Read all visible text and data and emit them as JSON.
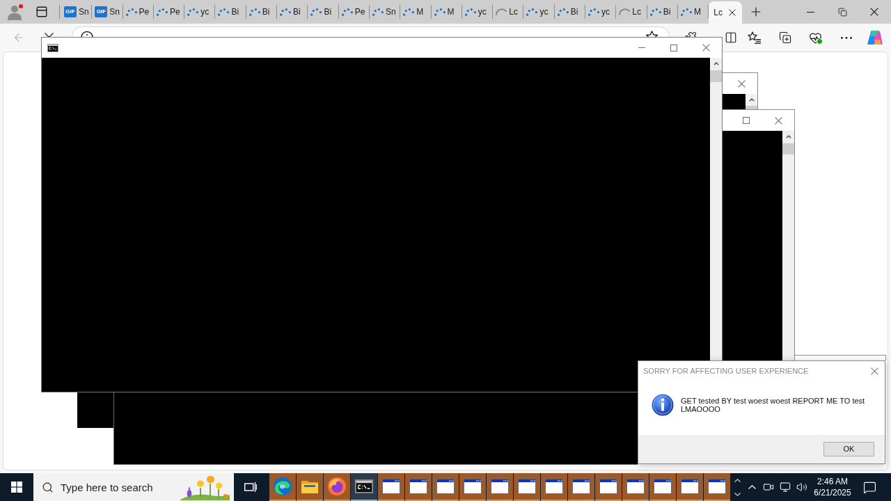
{
  "browser": {
    "back_disabled": true,
    "loading": true,
    "tabs": [
      {
        "kind": "gif",
        "badge": "GIF",
        "label": "Sn",
        "selected": false
      },
      {
        "kind": "gif",
        "badge": "GIF",
        "label": "Sn",
        "selected": false
      },
      {
        "kind": "spinner",
        "label": "Pe",
        "selected": false
      },
      {
        "kind": "spinner",
        "label": "Pe",
        "selected": false
      },
      {
        "kind": "spinner",
        "label": "yc",
        "selected": false
      },
      {
        "kind": "spinner",
        "label": "Bi",
        "selected": false
      },
      {
        "kind": "spinner",
        "label": "Bi",
        "selected": false
      },
      {
        "kind": "spinner",
        "label": "Bi",
        "selected": false
      },
      {
        "kind": "spinner",
        "label": "Bi",
        "selected": false
      },
      {
        "kind": "spinner",
        "label": "Pe",
        "selected": false
      },
      {
        "kind": "spinner",
        "label": "Sn",
        "selected": false
      },
      {
        "kind": "spinner",
        "label": "M",
        "selected": false
      },
      {
        "kind": "spinner",
        "label": "M",
        "selected": false
      },
      {
        "kind": "spinner",
        "label": "yc",
        "selected": false
      },
      {
        "kind": "stalled",
        "label": "Lc",
        "selected": false
      },
      {
        "kind": "spinner",
        "label": "yc",
        "selected": false
      },
      {
        "kind": "spinner",
        "label": "Bi",
        "selected": false
      },
      {
        "kind": "spinner",
        "label": "yc",
        "selected": false
      },
      {
        "kind": "stalled",
        "label": "Lc",
        "selected": false
      },
      {
        "kind": "spinner",
        "label": "Bi",
        "selected": false
      },
      {
        "kind": "spinner",
        "label": "M",
        "selected": false
      },
      {
        "kind": "plain",
        "label": "Lc",
        "selected": true
      }
    ]
  },
  "dialog": {
    "title": "SORRY FOR AFFECTING USER EXPERIENCE",
    "active": false,
    "message": "GET tested BY test woest woest REPORT ME TO test LMAOOOO",
    "buttons": [
      "OK"
    ]
  },
  "taskbar": {
    "search": {
      "placeholder": "Type here to search"
    },
    "apps": [
      {
        "kind": "edge",
        "selected": false,
        "flashing": true
      },
      {
        "kind": "explorer",
        "selected": false,
        "flashing": true
      },
      {
        "kind": "firefox",
        "selected": false,
        "flashing": true
      },
      {
        "kind": "console",
        "selected": true,
        "flashing": false
      },
      {
        "kind": "window",
        "selected": false,
        "flashing": true
      },
      {
        "kind": "window",
        "selected": false,
        "flashing": true
      },
      {
        "kind": "window",
        "selected": false,
        "flashing": true
      },
      {
        "kind": "window",
        "selected": false,
        "flashing": true
      },
      {
        "kind": "window",
        "selected": false,
        "flashing": true
      },
      {
        "kind": "window",
        "selected": false,
        "flashing": true
      },
      {
        "kind": "window",
        "selected": false,
        "flashing": true
      },
      {
        "kind": "window",
        "selected": false,
        "flashing": true
      },
      {
        "kind": "window",
        "selected": false,
        "flashing": true
      },
      {
        "kind": "window",
        "selected": false,
        "flashing": true
      },
      {
        "kind": "window",
        "selected": false,
        "flashing": true
      },
      {
        "kind": "window",
        "selected": false,
        "flashing": true
      },
      {
        "kind": "window",
        "selected": false,
        "flashing": true
      }
    ],
    "clock": {
      "time": "2:46 AM",
      "date": "6/21/2025"
    }
  }
}
